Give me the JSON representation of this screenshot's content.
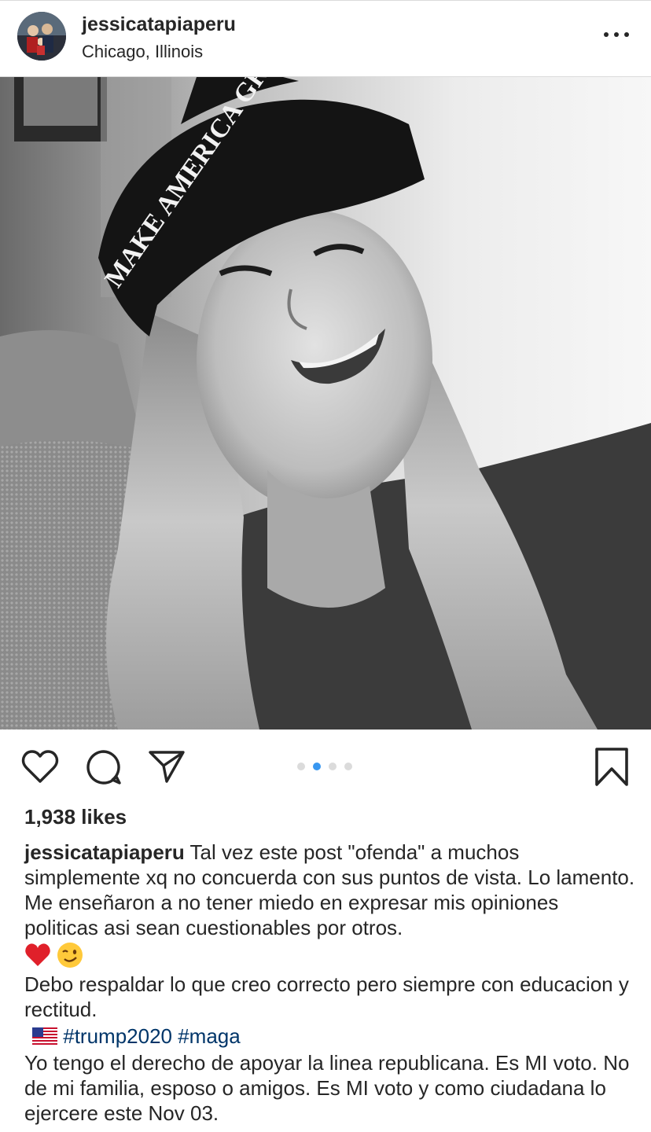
{
  "post": {
    "username": "jessicatapiaperu",
    "location": "Chicago, Illinois",
    "likes": "1,938 likes",
    "carousel": {
      "count": 4,
      "active_index": 1
    },
    "caption": {
      "username": "jessicatapiaperu",
      "line1": " Tal vez este post \"ofenda\" a muchos simplemente xq no concuerda con sus puntos de vista. Lo lamento. Me enseñaron a no tener miedo en expresar mis opiniones politicas asi sean cuestionables por otros.",
      "line2": "Debo respaldar lo que creo correcto pero siempre con educacion y rectitud.",
      "hashtags": "#trump2020 #maga",
      "line3": "Yo tengo el derecho de apoyar la linea republicana. Es MI voto. No de mi familia, esposo o amigos. Es MI voto y como ciudadana lo ejercere este Nov 03."
    }
  },
  "photo": {
    "cap_text": "MAKE AMERICA GREAT"
  },
  "icons": {
    "more": "more-options-icon",
    "like": "heart-icon",
    "comment": "comment-icon",
    "share": "share-icon",
    "save": "bookmark-icon",
    "emoji_heart": "red-heart-emoji",
    "emoji_wink": "wink-emoji",
    "emoji_flag": "us-flag-emoji"
  },
  "colors": {
    "hashtag": "#003569",
    "carousel_active": "#3897f0",
    "carousel_inactive": "#dbdbdb",
    "text": "#262626"
  }
}
